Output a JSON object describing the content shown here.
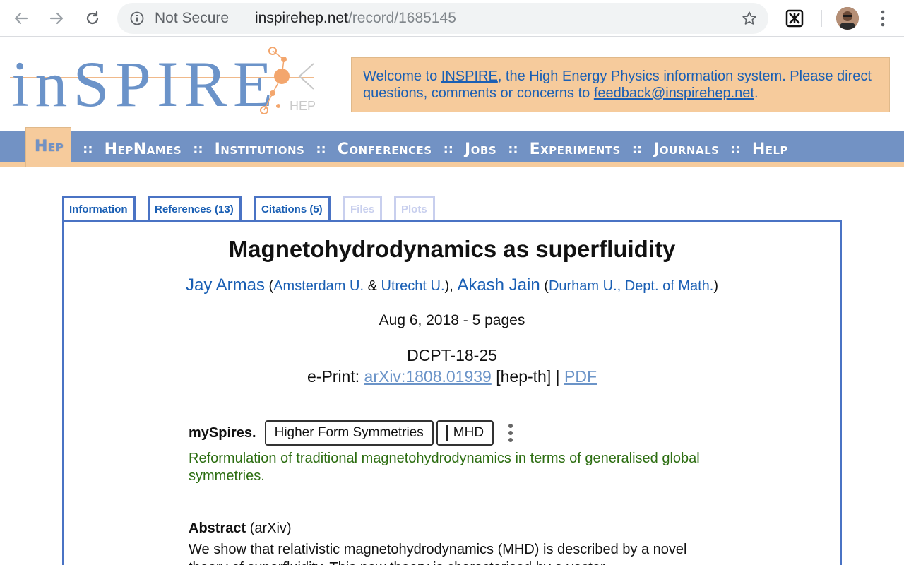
{
  "browser": {
    "security_label": "Not Secure",
    "url_host": "inspirehep.net",
    "url_path": "/record/1685145"
  },
  "header": {
    "logo_text": "inSPIRE",
    "logo_sub": "HEP",
    "welcome_prefix": "Welcome to ",
    "welcome_link": "INSPIRE",
    "welcome_mid": ", the High Energy Physics information system. Please direct questions, comments or concerns to ",
    "welcome_email": "feedback@inspirehep.net",
    "welcome_suffix": "."
  },
  "nav": {
    "items": [
      "Hep",
      "HepNames",
      "Institutions",
      "Conferences",
      "Jobs",
      "Experiments",
      "Journals",
      "Help"
    ],
    "separator": "::"
  },
  "tabs": [
    {
      "label": "Information"
    },
    {
      "label": "References (13)"
    },
    {
      "label": "Citations (5)"
    },
    {
      "label": "Files"
    },
    {
      "label": "Plots"
    }
  ],
  "record": {
    "title": "Magnetohydrodynamics as superfluidity",
    "author1": "Jay Armas",
    "aff1a": "Amsterdam U.",
    "aff_amp": "&",
    "aff1b": "Utrecht U.",
    "author2": "Akash Jain",
    "aff2": "Durham U., Dept. of Math.",
    "date_pages": "Aug 6, 2018 - 5 pages",
    "report_number": "DCPT-18-25",
    "eprint_label": "e-Print:",
    "eprint_id": "arXiv:1808.01939",
    "eprint_category": "[hep-th]",
    "eprint_sep": "|",
    "pdf_label": "PDF"
  },
  "myspires": {
    "label": "mySpires.",
    "tags": [
      "Higher Form Symmetries",
      "MHD"
    ],
    "note": "Reformulation of traditional magnetohydrodynamics in terms of generalised global symmetries."
  },
  "abstract": {
    "heading": "Abstract",
    "source": "(arXiv)",
    "text": "We show that relativistic magnetohydrodynamics (MHD) is described by a novel theory of superfluidity. This new theory is characterised by a vector"
  }
}
